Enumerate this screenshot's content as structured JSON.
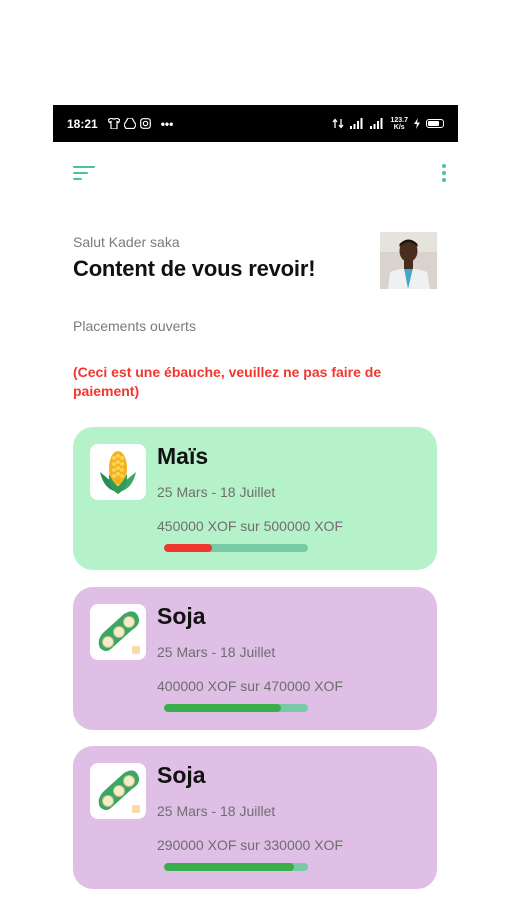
{
  "status_bar": {
    "time": "18:21",
    "notification_icons": [
      "shirt-icon",
      "drive-icon",
      "instagram-icon"
    ],
    "more_dots": "•••",
    "net_speed_value": "123.7",
    "net_speed_unit": "K/s"
  },
  "header": {
    "menu_icon": "menu-icon",
    "more_icon": "more-vertical-icon"
  },
  "greeting": "Salut Kader saka",
  "headline": "Content de vous revoir!",
  "section_title": "Placements ouverts",
  "warning": "(Ceci est une ébauche, veuillez ne pas faire de paiement)",
  "colors": {
    "accent": "#4cc3a0",
    "warning": "#f2362e",
    "card_green": "#b6f2c9",
    "card_purple": "#dfbfe6",
    "progress_red": "#f0352e",
    "progress_green": "#3bae4c",
    "progress_track": "#78c9a5"
  },
  "placements": [
    {
      "name": "Maïs",
      "icon": "corn-icon",
      "dates": "25 Mars - 18 Juillet",
      "amount": "450000 XOF sur 500000 XOF",
      "progress": 0.33,
      "progress_color": "#f0352e",
      "bg": "#b6f2c9"
    },
    {
      "name": "Soja",
      "icon": "soybean-icon",
      "dates": "25 Mars - 18 Juillet",
      "amount": "400000 XOF sur 470000 XOF",
      "progress": 0.81,
      "progress_color": "#3bae4c",
      "bg": "#dfbfe6"
    },
    {
      "name": "Soja",
      "icon": "soybean-icon",
      "dates": "25 Mars - 18 Juillet",
      "amount": "290000 XOF sur 330000 XOF",
      "progress": 0.9,
      "progress_color": "#3bae4c",
      "bg": "#dfbfe6"
    }
  ]
}
